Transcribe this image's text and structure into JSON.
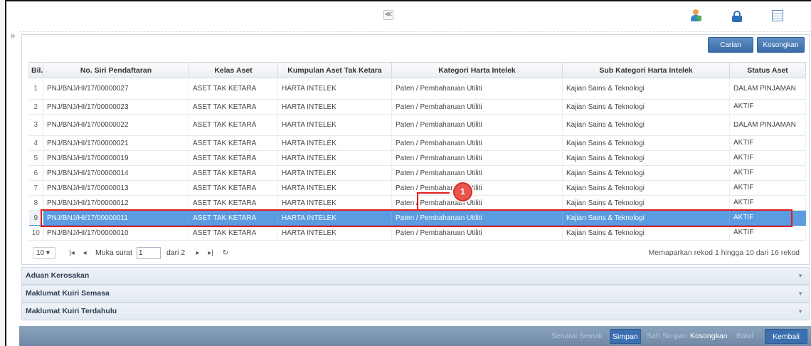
{
  "header": {
    "collapse_glyph": "≪",
    "icons": [
      "user-profile-icon",
      "lock-icon",
      "table-view-icon",
      "book-icon"
    ]
  },
  "sidebar_toggle": "»",
  "search_buttons": {
    "carian": "Carian",
    "kosongkan": "Kosongkan"
  },
  "table": {
    "columns": [
      "Bil.",
      "No. Siri Pendaftaran",
      "Kelas Aset",
      "Kumpulan Aset Tak Ketara",
      "Kategori Harta Intelek",
      "Sub Kategori Harta Intelek",
      "Status Aset"
    ],
    "rows": [
      {
        "bil": "1",
        "no_siri": "PNJ/BNJ/HI/17/00000027",
        "kelas": "ASET TAK KETARA",
        "kumpulan": "HARTA INTELEK",
        "kategori": "Paten / Pembaharuan Utiliti",
        "sub_kategori": "Kajian Sains & Teknologi",
        "status": "DALAM PINJAMAN"
      },
      {
        "bil": "2",
        "no_siri": "PNJ/BNJ/HI/17/00000023",
        "kelas": "ASET TAK KETARA",
        "kumpulan": "HARTA INTELEK",
        "kategori": "Paten / Pembaharuan Utiliti",
        "sub_kategori": "Kajian Sains & Teknologi",
        "status": "AKTIF"
      },
      {
        "bil": "3",
        "no_siri": "PNJ/BNJ/HI/17/00000022",
        "kelas": "ASET TAK KETARA",
        "kumpulan": "HARTA INTELEK",
        "kategori": "Paten / Pembaharuan Utiliti",
        "sub_kategori": "Kajian Sains & Teknologi",
        "status": "DALAM PINJAMAN"
      },
      {
        "bil": "4",
        "no_siri": "PNJ/BNJ/HI/17/00000021",
        "kelas": "ASET TAK KETARA",
        "kumpulan": "HARTA INTELEK",
        "kategori": "Paten / Pembaharuan Utiliti",
        "sub_kategori": "Kajian Sains & Teknologi",
        "status": "AKTIF"
      },
      {
        "bil": "5",
        "no_siri": "PNJ/BNJ/HI/17/00000019",
        "kelas": "ASET TAK KETARA",
        "kumpulan": "HARTA INTELEK",
        "kategori": "Paten / Pembaharuan Utiliti",
        "sub_kategori": "Kajian Sains & Teknologi",
        "status": "AKTIF"
      },
      {
        "bil": "6",
        "no_siri": "PNJ/BNJ/HI/17/00000014",
        "kelas": "ASET TAK KETARA",
        "kumpulan": "HARTA INTELEK",
        "kategori": "Paten / Pembaharuan Utiliti",
        "sub_kategori": "Kajian Sains & Teknologi",
        "status": "AKTIF"
      },
      {
        "bil": "7",
        "no_siri": "PNJ/BNJ/HI/17/00000013",
        "kelas": "ASET TAK KETARA",
        "kumpulan": "HARTA INTELEK",
        "kategori": "Paten / Pembaharuan Utiliti",
        "sub_kategori": "Kajian Sains & Teknologi",
        "status": "AKTIF"
      },
      {
        "bil": "8",
        "no_siri": "PNJ/BNJ/HI/17/00000012",
        "kelas": "ASET TAK KETARA",
        "kumpulan": "HARTA INTELEK",
        "kategori": "Paten / Pembaharuan Utiliti",
        "sub_kategori": "Kajian Sains & Teknologi",
        "status": "AKTIF"
      },
      {
        "bil": "9",
        "no_siri": "PNJ/BNJ/HI/17/00000011",
        "kelas": "ASET TAK KETARA",
        "kumpulan": "HARTA INTELEK",
        "kategori": "Paten / Pembaharuan Utiliti",
        "sub_kategori": "Kajian Sains & Teknologi",
        "status": "AKTIF"
      },
      {
        "bil": "10",
        "no_siri": "PNJ/BNJ/HI/17/00000010",
        "kelas": "ASET TAK KETARA",
        "kumpulan": "HARTA INTELEK",
        "kategori": "Paten / Pembaharuan Utiliti",
        "sub_kategori": "Kajian Sains & Teknologi",
        "status": "AKTIF"
      }
    ],
    "selected_row": 9
  },
  "callout": {
    "number": "1",
    "color": "#e21d1d"
  },
  "pager": {
    "page_size": "10 ▾",
    "first": "|◂",
    "prev": "◂",
    "page_label": "Muka surat",
    "page_value": "1",
    "of_label": "dari 2",
    "next": "▸",
    "last": "▸|",
    "refresh": "↻",
    "info": "Memaparkan rekod 1 hingga 10 dari 16 rekod"
  },
  "accordions": [
    {
      "label": "Aduan Kerosakan"
    },
    {
      "label": "Maklumat Kuiri Semasa"
    },
    {
      "label": "Maklumat Kuiri Terdahulu"
    }
  ],
  "footer": {
    "senarai_semak": "Senarai Semak",
    "simpan": "Simpan",
    "sah_simpan": "Sah Simpan",
    "kosongkan": "Kosongkan",
    "batal": "Batal",
    "kembali": "Kembali"
  },
  "colors": {
    "selected_row": "#5b9be0",
    "footer_bar": "#7a93ae",
    "button_blue": "#3b6ca9"
  }
}
